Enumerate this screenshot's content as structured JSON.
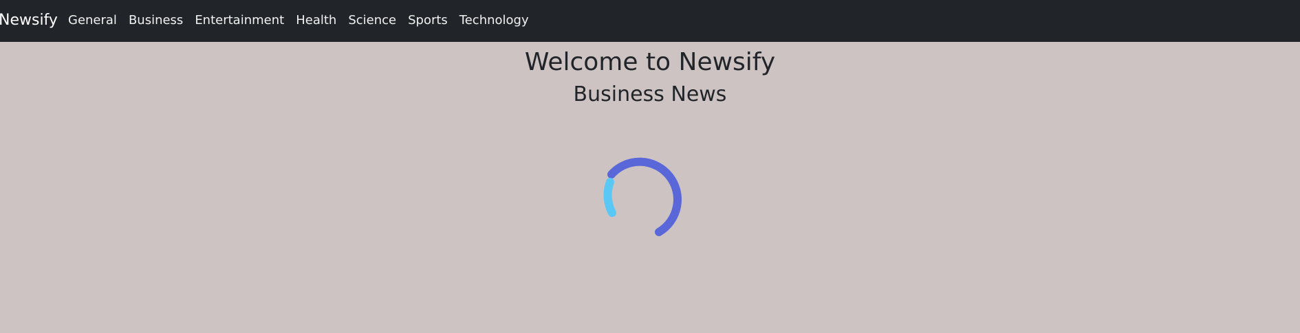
{
  "navbar": {
    "brand": "Newsify",
    "links": [
      "General",
      "Business",
      "Entertainment",
      "Health",
      "Science",
      "Sports",
      "Technology"
    ]
  },
  "main": {
    "title": "Welcome to Newsify",
    "subtitle": "Business News"
  },
  "spinner": {
    "icon": "loading-spinner-icon",
    "primary_color": "#5a67d8",
    "secondary_color": "#5ac8f5"
  },
  "colors": {
    "navbar_bg": "#212529",
    "page_bg": "#cdc3c3",
    "text": "#212529"
  }
}
